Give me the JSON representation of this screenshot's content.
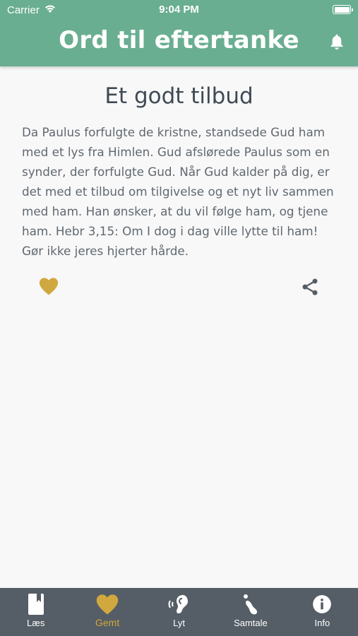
{
  "status": {
    "carrier": "Carrier",
    "time": "9:04 PM"
  },
  "header": {
    "title": "Ord til eftertanke"
  },
  "article": {
    "title": "Et godt tilbud",
    "body": "Da Paulus forfulgte de kristne, standsede Gud ham med et lys fra Himlen. Gud afslørede Paulus som en synder, der forfulgte Gud. Når Gud kalder på dig, er det med et tilbud om tilgivelse og et nyt liv sammen med ham. Han ønsker, at du vil følge ham, og tjene ham. Hebr 3,15: Om I dog i dag ville lytte til ham! Gør ikke jeres hjerter hårde."
  },
  "tabs": [
    {
      "label": "Læs",
      "icon": "book-icon"
    },
    {
      "label": "Gemt",
      "icon": "heart-icon",
      "active": true
    },
    {
      "label": "Lyt",
      "icon": "ear-icon"
    },
    {
      "label": "Samtale",
      "icon": "footprint-icon"
    },
    {
      "label": "Info",
      "icon": "info-icon"
    }
  ],
  "colors": {
    "header": "#6aae91",
    "accent": "#d1a83f",
    "tabbar": "#555d66",
    "background": "#f8f8f8"
  }
}
